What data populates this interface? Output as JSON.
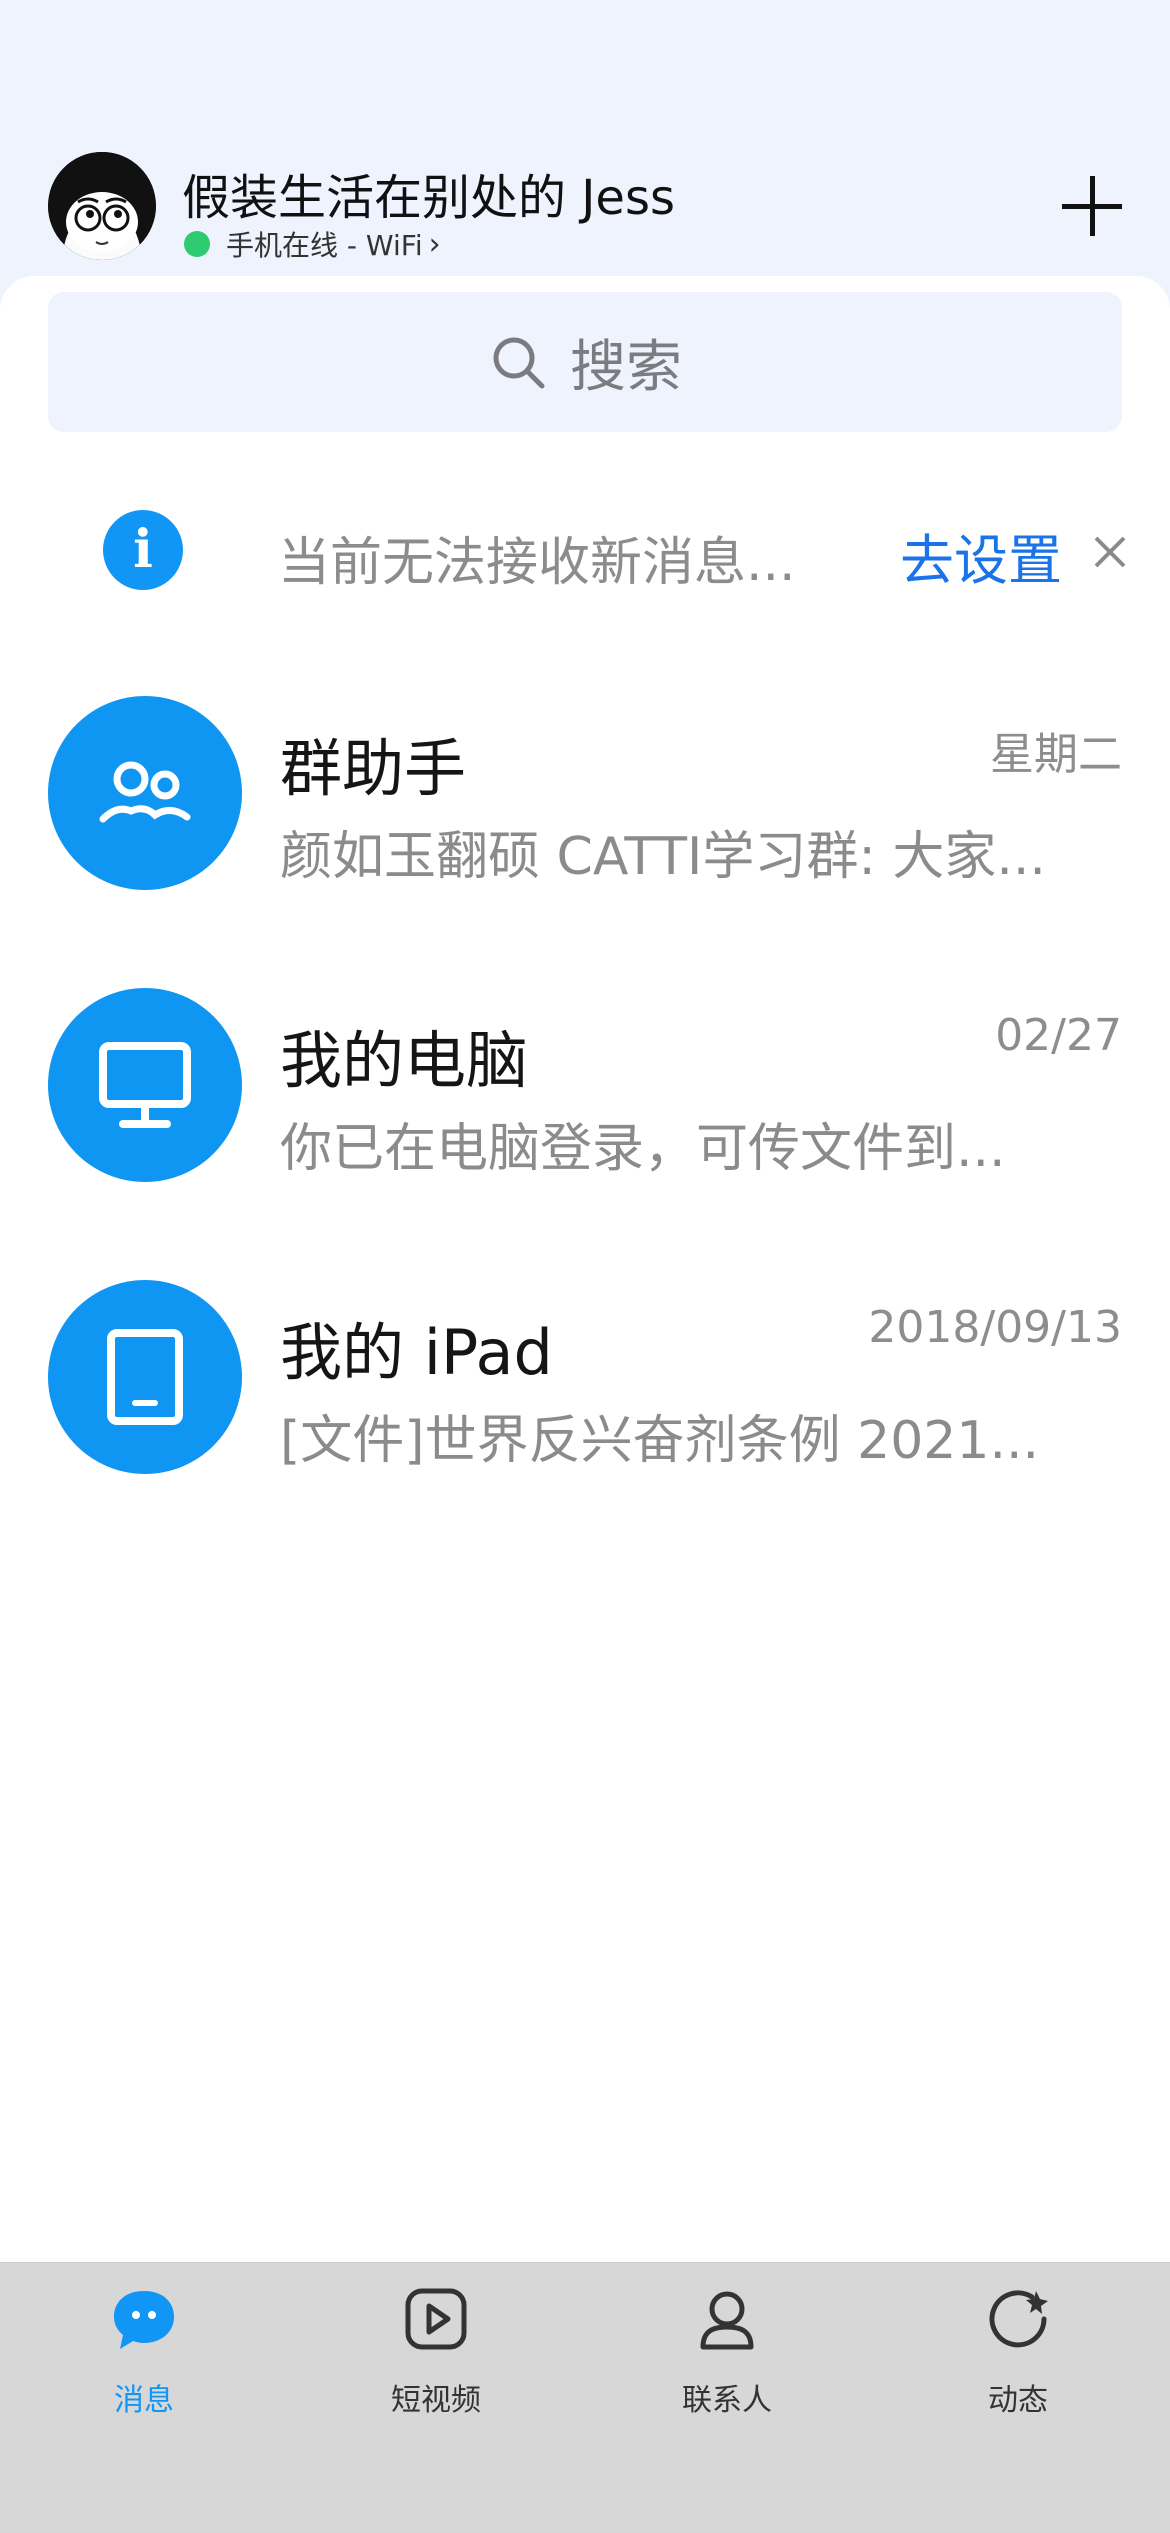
{
  "header": {
    "username": "假装生活在别处的 Jess",
    "status": "手机在线 - WiFi",
    "status_chevron": "›",
    "online_color": "#2ecc71"
  },
  "search": {
    "placeholder": "搜索"
  },
  "notice": {
    "icon": "info-icon",
    "text": "当前无法接收新消息...",
    "link": "去设置",
    "close_icon": "close-icon"
  },
  "chats": [
    {
      "name": "群助手",
      "time": "星期二",
      "preview": "颜如玉翻硕 CATTI学习群: 大家...",
      "icon": "group-icon"
    },
    {
      "name": "我的电脑",
      "time": "02/27",
      "preview": "你已在电脑登录，可传文件到...",
      "icon": "monitor-icon"
    },
    {
      "name": "我的 iPad",
      "time": "2018/09/13",
      "preview": "[文件]世界反兴奋剂条例 2021...",
      "icon": "tablet-icon"
    }
  ],
  "tabs": [
    {
      "label": "消息",
      "icon": "message-icon",
      "active": true
    },
    {
      "label": "短视频",
      "icon": "video-icon",
      "active": false
    },
    {
      "label": "联系人",
      "icon": "contact-icon",
      "active": false
    },
    {
      "label": "动态",
      "icon": "moments-icon",
      "active": false
    }
  ],
  "colors": {
    "accent": "#1296f5",
    "link": "#1a73e8",
    "background": "#eef3fe",
    "tabbar": "#d7d7d8"
  }
}
